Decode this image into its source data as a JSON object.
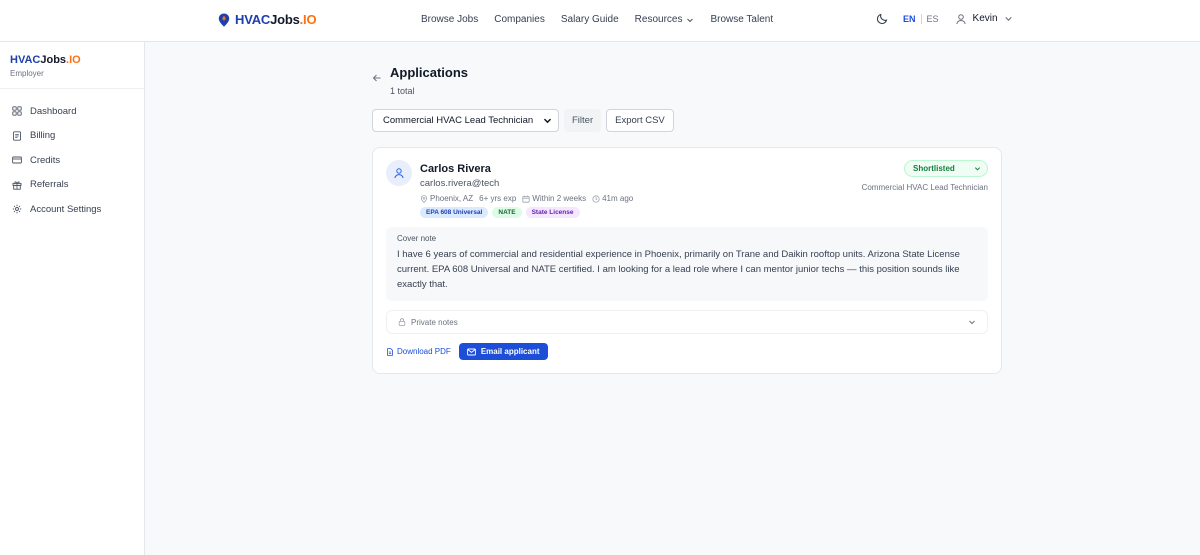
{
  "brand": {
    "part1": "HVAC",
    "part2": "Jobs",
    "part3": ".IO"
  },
  "nav": {
    "items": [
      "Browse Jobs",
      "Companies",
      "Salary Guide",
      "Resources",
      "Browse Talent"
    ]
  },
  "lang": {
    "en": "EN",
    "es": "ES"
  },
  "user": {
    "name": "Kevin"
  },
  "sidebar": {
    "brand": {
      "part1": "HVAC",
      "part2": "Jobs",
      "part3": ".IO"
    },
    "role": "Employer",
    "items": [
      {
        "label": "Dashboard",
        "icon": "grid-icon"
      },
      {
        "label": "Billing",
        "icon": "receipt-icon"
      },
      {
        "label": "Credits",
        "icon": "card-icon"
      },
      {
        "label": "Referrals",
        "icon": "gift-icon"
      },
      {
        "label": "Account Settings",
        "icon": "gear-icon"
      }
    ]
  },
  "page": {
    "title": "Applications",
    "subtitle": "1 total"
  },
  "toolbar": {
    "job_select": "Commercial HVAC Lead Technician",
    "filter": "Filter",
    "export": "Export CSV"
  },
  "application": {
    "name": "Carlos Rivera",
    "email": "carlos.rivera@tech",
    "location": "Phoenix, AZ",
    "experience": "6+ yrs exp",
    "availability": "Within 2 weeks",
    "time_ago": "41m ago",
    "tags": [
      "EPA 608 Universal",
      "NATE",
      "State License"
    ],
    "status": "Shortlisted",
    "job": "Commercial HVAC Lead Technician",
    "cover_label": "Cover note",
    "cover_text": "I have 6 years of commercial and residential experience in Phoenix, primarily on Trane and Daikin rooftop units. Arizona State License current. EPA 608 Universal and NATE certified. I am looking for a lead role where I can mentor junior techs — this position sounds like exactly that.",
    "private_notes": "Private notes",
    "download": "Download PDF",
    "email_button": "Email applicant"
  },
  "colors": {
    "accent": "#1d4ed8",
    "brand_orange": "#f97316",
    "status_green": "#15803d"
  }
}
